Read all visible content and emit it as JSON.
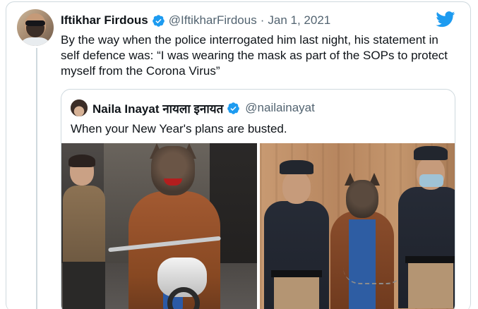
{
  "tweet": {
    "author_name": "Iftikhar Firdous",
    "author_handle": "@IftikharFirdous",
    "separator": "·",
    "date": "Jan 1, 2021",
    "text": "By the way when the police interrogated him last night, his statement in self defence was: “I was wearing the mask as part of the SOPs to protect myself from the Corona Virus”"
  },
  "quoted_tweet": {
    "author_name": "Naila Inayat नायला इनायत",
    "author_handle": "@nailainayat",
    "text": "When your New Year's plans are busted."
  },
  "colors": {
    "verified_blue": "#1d9bf0",
    "twitter_blue": "#1d9bf0",
    "secondary_text": "#536471",
    "border": "#cfd9de"
  },
  "icons": {
    "brand": "twitter-bird-icon",
    "verified": "verified-badge-icon"
  }
}
